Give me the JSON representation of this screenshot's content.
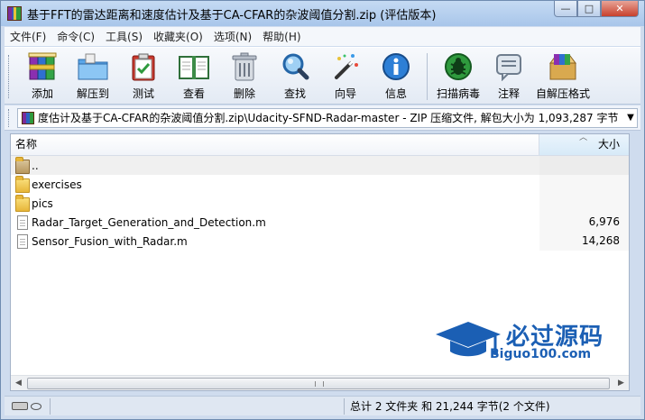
{
  "window": {
    "title": "基于FFT的雷达距离和速度估计及基于CA-CFAR的杂波阈值分割.zip (评估版本)",
    "minimize_label": "—",
    "maximize_label": "□",
    "close_label": "✕"
  },
  "menu": {
    "items": [
      {
        "label": "文件(F)"
      },
      {
        "label": "命令(C)"
      },
      {
        "label": "工具(S)"
      },
      {
        "label": "收藏夹(O)"
      },
      {
        "label": "选项(N)"
      },
      {
        "label": "帮助(H)"
      }
    ]
  },
  "toolbar": {
    "buttons": [
      {
        "label": "添加",
        "icon": "books-add-icon"
      },
      {
        "label": "解压到",
        "icon": "folder-extract-icon"
      },
      {
        "label": "测试",
        "icon": "clipboard-check-icon"
      },
      {
        "label": "查看",
        "icon": "open-book-icon"
      },
      {
        "label": "删除",
        "icon": "trash-icon"
      },
      {
        "label": "查找",
        "icon": "magnifier-icon"
      },
      {
        "label": "向导",
        "icon": "magic-wand-icon"
      },
      {
        "label": "信息",
        "icon": "info-icon"
      },
      {
        "label": "扫描病毒",
        "icon": "bug-scan-icon"
      },
      {
        "label": "注释",
        "icon": "comment-icon"
      },
      {
        "label": "自解压格式",
        "icon": "sfx-box-icon"
      }
    ]
  },
  "address": {
    "path": "度估计及基于CA-CFAR的杂波阈值分割.zip\\Udacity-SFND-Radar-master - ZIP 压缩文件, 解包大小为 1,093,287 字节"
  },
  "list": {
    "columns": {
      "name": "名称",
      "size": "大小"
    },
    "rows": [
      {
        "name": "..",
        "size": "",
        "type": "parent"
      },
      {
        "name": "exercises",
        "size": "",
        "type": "folder"
      },
      {
        "name": "pics",
        "size": "",
        "type": "folder"
      },
      {
        "name": "Radar_Target_Generation_and_Detection.m",
        "size": "6,976",
        "type": "file"
      },
      {
        "name": "Sensor_Fusion_with_Radar.m",
        "size": "14,268",
        "type": "file"
      }
    ]
  },
  "watermark": {
    "brand": "必过源码",
    "site": "Biguo100.com"
  },
  "status": {
    "summary": "总计 2 文件夹 和 21,244 字节(2 个文件)"
  },
  "colors": {
    "title_bar": "#a8c6ea",
    "watermark_blue": "#1b5fb4"
  }
}
